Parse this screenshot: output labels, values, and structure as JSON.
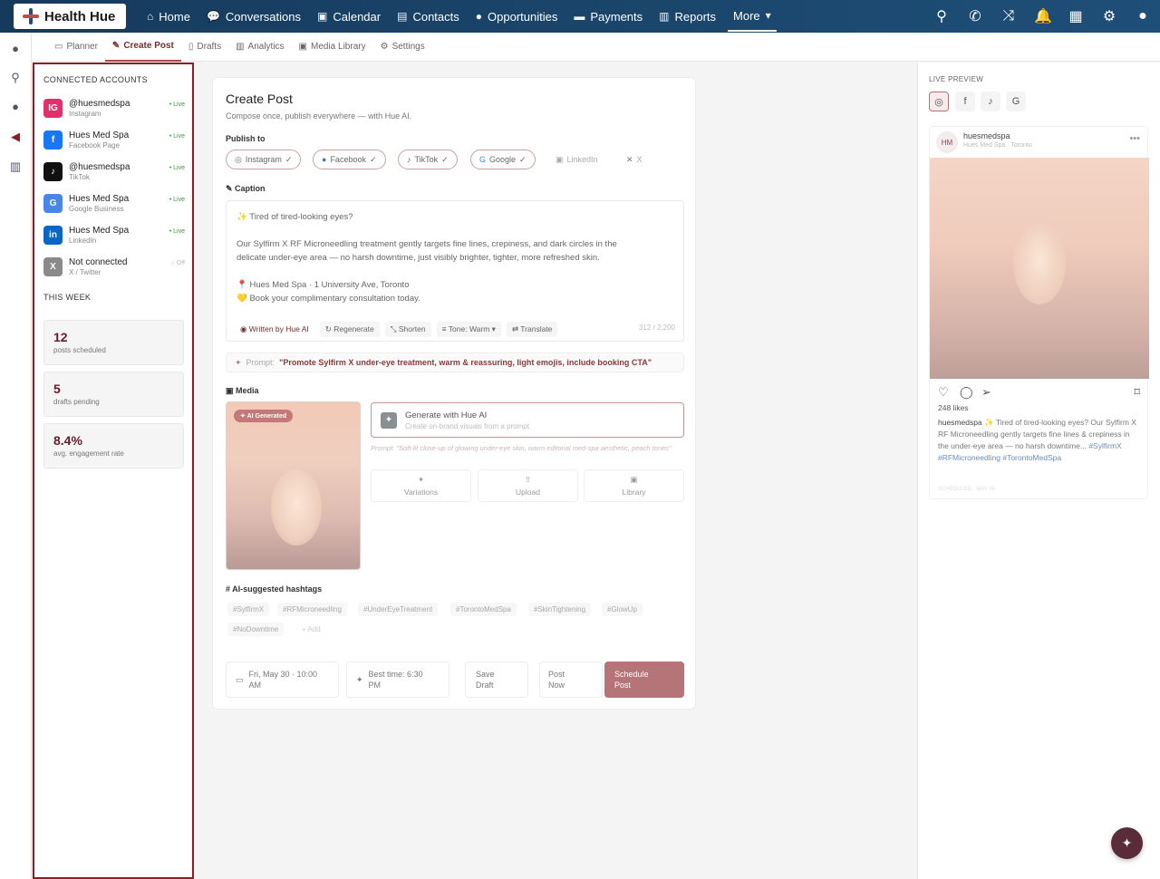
{
  "app": {
    "name": "Health Hue"
  },
  "nav": {
    "home": "Home",
    "conversations": "Conversations",
    "calendar": "Calendar",
    "contacts": "Contacts",
    "opportunities": "Opportunities",
    "payments": "Payments",
    "reports": "Reports",
    "more": "More"
  },
  "top_icons": [
    "search-icon",
    "phone-icon",
    "shuffle-icon",
    "bell-icon",
    "calendar-icon",
    "gear-icon",
    "user-icon"
  ],
  "subnav": {
    "planner": "Planner",
    "create_post": "Create Post",
    "drafts": "Drafts",
    "analytics": "Analytics",
    "media_library": "Media Library",
    "settings": "Settings"
  },
  "left": {
    "accounts_title": "CONNECTED ACCOUNTS",
    "accounts": [
      {
        "name": "@huesmedspa",
        "platform": "Instagram",
        "status": "• Live",
        "color": "#e1306c",
        "icon": "IG"
      },
      {
        "name": "Hues Med Spa",
        "platform": "Facebook Page",
        "status": "• Live",
        "color": "#1877f2",
        "icon": "f"
      },
      {
        "name": "@huesmedspa",
        "platform": "TikTok",
        "status": "• Live",
        "color": "#111111",
        "icon": "♪"
      },
      {
        "name": "Hues Med Spa",
        "platform": "Google Business",
        "status": "• Live",
        "color": "#4a86e8",
        "icon": "G"
      },
      {
        "name": "Hues Med Spa",
        "platform": "LinkedIn",
        "status": "• Live",
        "color": "#0a66c2",
        "icon": "in"
      },
      {
        "name": "Not connected",
        "platform": "X / Twitter",
        "status": "○ Off",
        "color": "#8a8a8a",
        "icon": "X"
      }
    ],
    "week_title": "THIS WEEK",
    "stats": [
      {
        "value": "12",
        "label": "posts scheduled"
      },
      {
        "value": "5",
        "label": "drafts pending"
      },
      {
        "value": "8.4%",
        "label": "avg. engagement rate"
      }
    ]
  },
  "main": {
    "title": "Create Post",
    "subtitle": "Compose once, publish everywhere — with Hue AI.",
    "publish_label": "Publish to",
    "channels": [
      "Instagram",
      "Facebook",
      "TikTok",
      "Google",
      "LinkedIn",
      "X"
    ],
    "caption_label": "Caption",
    "caption": {
      "line1": "Tired of tired-looking eyes?",
      "line2": "Our Sylfirm X RF Microneedling treatment gently targets fine lines, crepiness, and dark circles in the",
      "line3": "delicate under-eye area — no harsh downtime, just visibly brighter, tighter, more refreshed skin.",
      "line4": "Hues Med Spa · 1 University Ave, Toronto",
      "line5": "Book your complimentary consultation today."
    },
    "tools": {
      "written": "Written by Hue AI",
      "regenerate": "Regenerate",
      "shorten": "Shorten",
      "tone": "Tone: Warm",
      "translate": "Translate"
    },
    "char_count": "312 / 2,200",
    "prompt_label": "Prompt:",
    "prompt_text": "\"Promote Sylfirm X under-eye treatment, warm & reassuring, light emojis, include booking CTA\"",
    "media_label": "Media",
    "ai_badge": "AI Generated",
    "generate_title": "Generate with Hue AI",
    "generate_sub": "Create on-brand visuals from a prompt",
    "generate_prompt": "Prompt: \"Soft-lit close-up of glowing under-eye skin, warm editorial med-spa aesthetic, peach tones\"",
    "media_buttons": [
      "Variations",
      "Upload",
      "Library"
    ],
    "hashtags_label": "AI-suggested hashtags",
    "hashtags": [
      "#SylfirmX",
      "#RFMicroneedling",
      "#UnderEyeTreatment",
      "#TorontoMedSpa",
      "#SkinTightening",
      "#GlowUp",
      "#NoDowntime",
      "+ Add"
    ],
    "date": {
      "line1": "Fri, May 30 · 10:00",
      "line2": "AM"
    },
    "best": {
      "line1": "Best time: 6:30",
      "line2": "PM"
    },
    "save": {
      "line1": "Save",
      "line2": "Draft"
    },
    "post": {
      "line1": "Post",
      "line2": "Now"
    },
    "schedule": {
      "line1": "Schedule",
      "line2": "Post"
    }
  },
  "preview": {
    "title": "LIVE PREVIEW",
    "avatar": "HM",
    "username": "huesmedspa",
    "location": "Hues Med Spa · Toronto",
    "likes": "248 likes",
    "cap_user": "huesmedspa",
    "cap_text": "✨ Tired of tired-looking eyes? Our Sylfirm X RF Microneedling gently targets fine lines & crepiness in the under-eye area — no harsh downtime...",
    "cap_tags": "#SylfirmX #RFMicroneedling #TorontoMedSpa",
    "date": "SCHEDULED · MAY 30"
  }
}
